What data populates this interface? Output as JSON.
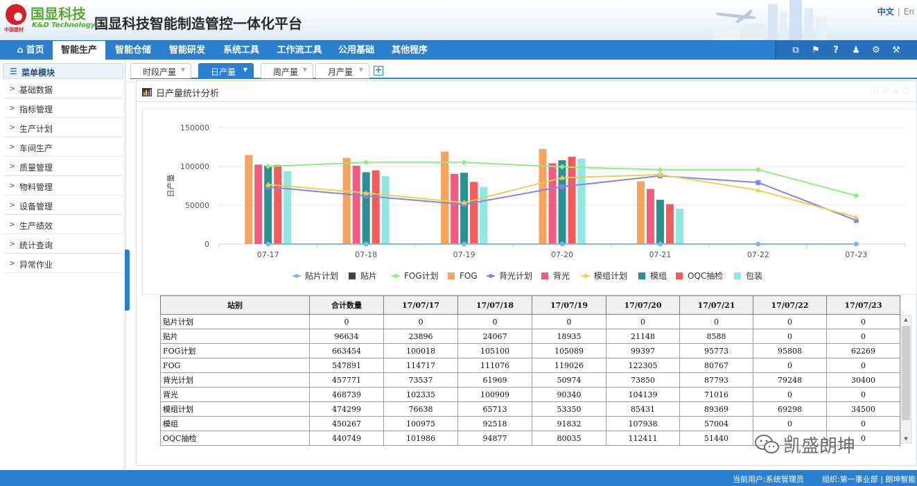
{
  "app": {
    "logo_cn": "国显科技",
    "logo_en": "K&D Technology",
    "logo_sub": "中国建材",
    "title": "国显科技智能制造管控一体化平台",
    "lang_active": "中文",
    "lang_other": "En"
  },
  "topnav": {
    "items": [
      {
        "label": "首页"
      },
      {
        "label": "智能生产"
      },
      {
        "label": "智能仓储"
      },
      {
        "label": "智能研发"
      },
      {
        "label": "系统工具"
      },
      {
        "label": "工作流工具"
      },
      {
        "label": "公用基础"
      },
      {
        "label": "其他程序"
      }
    ],
    "active_index": 1
  },
  "sidebar": {
    "title": "菜单模块",
    "items": [
      {
        "label": "基础数据"
      },
      {
        "label": "指标管理"
      },
      {
        "label": "生产计划"
      },
      {
        "label": "车间生产"
      },
      {
        "label": "质量管理"
      },
      {
        "label": "物料管理"
      },
      {
        "label": "设备管理"
      },
      {
        "label": "生产绩效"
      },
      {
        "label": "统计查询"
      },
      {
        "label": "异常作业"
      }
    ]
  },
  "tabs": [
    {
      "label": "时段产量"
    },
    {
      "label": "日产量"
    },
    {
      "label": "周产量"
    },
    {
      "label": "月产量"
    }
  ],
  "panel": {
    "title": "日产量统计分析"
  },
  "colors": {
    "primary": "#2b7fcf",
    "贴片计划": "#7cb5ec",
    "贴片": "#434348",
    "FOG计划": "#90ed7d",
    "FOG": "#f7a35c",
    "背光计划": "#8085e9",
    "背光": "#f15c80",
    "模组计划": "#e4d354",
    "模组": "#2b908f",
    "OQC抽检": "#f45b5b",
    "包装": "#91e8e1"
  },
  "chart_data": {
    "type": "bar",
    "categories": [
      "07-17",
      "07-18",
      "07-19",
      "07-20",
      "07-21",
      "07-22",
      "07-23"
    ],
    "ylabel": "日产量",
    "ylim": [
      0,
      150000
    ],
    "yticks": [
      "150000",
      "100000",
      "50000",
      "0"
    ],
    "legend_position": "bottom",
    "bar_series": [
      {
        "name": "FOG",
        "values": [
          114717,
          111076,
          119026,
          122305,
          80767,
          0,
          0
        ]
      },
      {
        "name": "背光",
        "values": [
          102335,
          100909,
          90340,
          104139,
          71016,
          0,
          0
        ]
      },
      {
        "name": "模组",
        "values": [
          100975,
          92518,
          91832,
          107938,
          57004,
          0,
          0
        ]
      },
      {
        "name": "OQC抽检",
        "values": [
          101986,
          94877,
          80035,
          112411,
          51440,
          0,
          0
        ]
      },
      {
        "name": "包装",
        "values": [
          94000,
          87500,
          73500,
          110000,
          45500,
          0,
          0
        ]
      }
    ],
    "line_series": [
      {
        "name": "贴片计划",
        "values": [
          0,
          0,
          0,
          0,
          0,
          0,
          0
        ]
      },
      {
        "name": "FOG计划",
        "values": [
          100018,
          105100,
          105089,
          99397,
          95773,
          95808,
          62269
        ]
      },
      {
        "name": "背光计划",
        "values": [
          73537,
          61969,
          50974,
          73850,
          87793,
          79248,
          30400
        ]
      },
      {
        "name": "模组计划",
        "values": [
          76638,
          65713,
          53350,
          85431,
          89369,
          69298,
          34500
        ]
      }
    ],
    "legend": [
      "贴片计划",
      "贴片",
      "FOG计划",
      "FOG",
      "背光计划",
      "背光",
      "模组计划",
      "模组",
      "OQC抽检",
      "包装"
    ]
  },
  "table": {
    "headers": [
      "站别",
      "合计数量",
      "17/07/17",
      "17/07/18",
      "17/07/19",
      "17/07/20",
      "17/07/21",
      "17/07/22",
      "17/07/23"
    ],
    "rows": [
      [
        "贴片计划",
        "0",
        "0",
        "0",
        "0",
        "0",
        "0",
        "0",
        "0"
      ],
      [
        "贴片",
        "96634",
        "23896",
        "24067",
        "18935",
        "21148",
        "8588",
        "0",
        "0"
      ],
      [
        "FOG计划",
        "663454",
        "100018",
        "105100",
        "105089",
        "99397",
        "95773",
        "95808",
        "62269"
      ],
      [
        "FOG",
        "547891",
        "114717",
        "111076",
        "119026",
        "122305",
        "80767",
        "0",
        "0"
      ],
      [
        "背光计划",
        "457771",
        "73537",
        "61969",
        "50974",
        "73850",
        "87793",
        "79248",
        "30400"
      ],
      [
        "背光",
        "468739",
        "102335",
        "100909",
        "90340",
        "104139",
        "71016",
        "0",
        "0"
      ],
      [
        "模组计划",
        "474299",
        "76638",
        "65713",
        "53350",
        "85431",
        "89369",
        "69298",
        "34500"
      ],
      [
        "模组",
        "450267",
        "100975",
        "92518",
        "91832",
        "107938",
        "57004",
        "0",
        "0"
      ],
      [
        "OQC抽检",
        "440749",
        "101986",
        "94877",
        "80035",
        "112411",
        "51440",
        "0",
        "0"
      ]
    ]
  },
  "watermark": {
    "text": "凯盛朗坤"
  },
  "statusbar": {
    "user": "当前用户:系统管理员",
    "org": "组织:第一事业部 | 朗坤智能"
  }
}
